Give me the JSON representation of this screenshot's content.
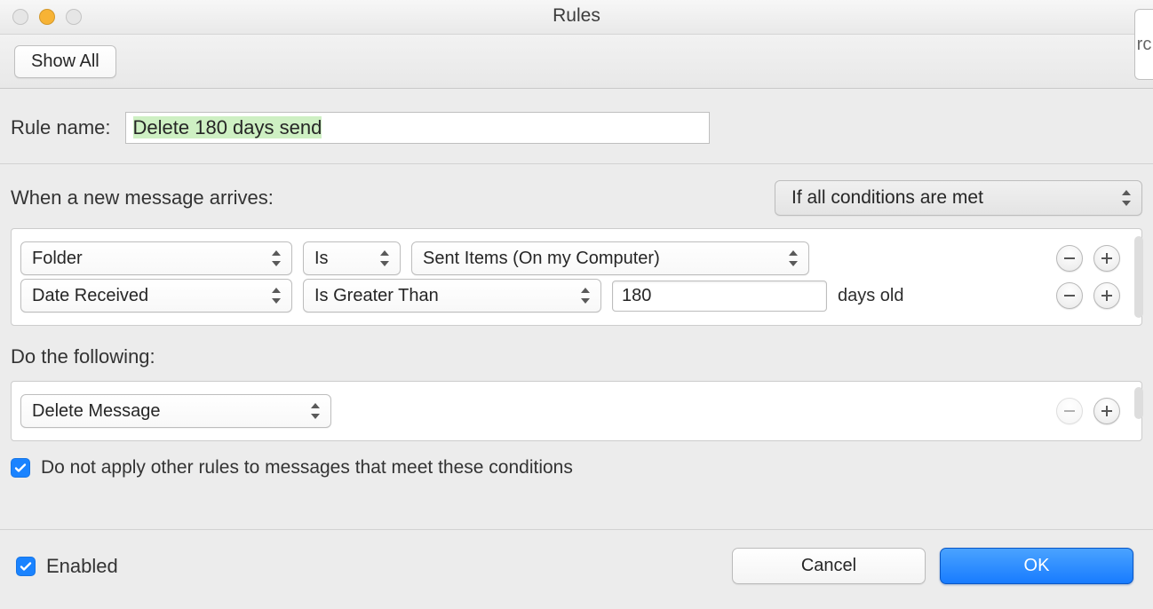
{
  "window": {
    "title": "Rules",
    "traffic_colors": {
      "close": "#e6e6e6",
      "min": "#f7b335",
      "zoom": "#e6e6e6"
    },
    "edge_tab_text": "rc"
  },
  "toolbar": {
    "show_all": "Show All"
  },
  "rule_name": {
    "label": "Rule name:",
    "value": "Delete 180 days send"
  },
  "conditions": {
    "header": "When a new message arrives:",
    "match_mode": "If all conditions are met",
    "rows": [
      {
        "field": "Folder",
        "operator": "Is",
        "value": "Sent Items (On my Computer)",
        "num": "",
        "suffix": ""
      },
      {
        "field": "Date Received",
        "operator": "Is Greater Than",
        "value": "",
        "num": "180",
        "suffix": "days old"
      }
    ]
  },
  "actions": {
    "header": "Do the following:",
    "rows": [
      {
        "action": "Delete Message"
      }
    ]
  },
  "do_not_apply": {
    "checked": true,
    "label": "Do not apply other rules to messages that meet these conditions"
  },
  "footer": {
    "enabled_checked": true,
    "enabled_label": "Enabled",
    "cancel": "Cancel",
    "ok": "OK"
  }
}
